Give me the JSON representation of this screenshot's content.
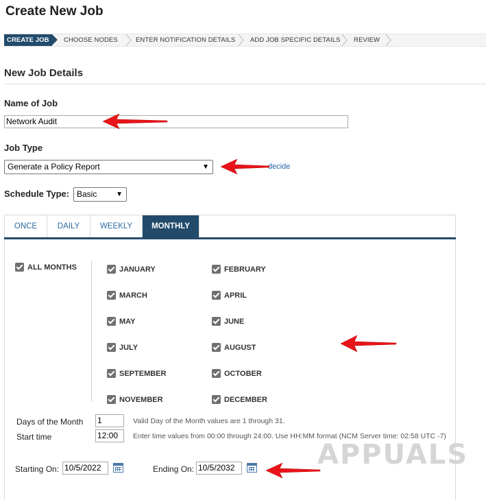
{
  "page": {
    "title": "Create New Job"
  },
  "wizard": {
    "steps": [
      {
        "label": "CREATE JOB"
      },
      {
        "label": "CHOOSE NODES"
      },
      {
        "label": "ENTER NOTIFICATION DETAILS"
      },
      {
        "label": "ADD JOB SPECIFIC DETAILS"
      },
      {
        "label": "REVIEW"
      }
    ]
  },
  "section": {
    "title": "New Job Details"
  },
  "name_of_job": {
    "label": "Name of Job",
    "value": "Network Audit"
  },
  "job_type": {
    "label": "Job Type",
    "selected": "Generate a Policy Report",
    "help_link": "decide"
  },
  "schedule_type": {
    "label": "Schedule Type:",
    "selected": "Basic"
  },
  "tabs": [
    {
      "label": "ONCE"
    },
    {
      "label": "DAILY"
    },
    {
      "label": "WEEKLY"
    },
    {
      "label": "MONTHLY"
    }
  ],
  "months": {
    "all_label": "ALL MONTHS",
    "items": [
      {
        "label": "JANUARY",
        "checked": true
      },
      {
        "label": "FEBRUARY",
        "checked": true
      },
      {
        "label": "MARCH",
        "checked": true
      },
      {
        "label": "APRIL",
        "checked": true
      },
      {
        "label": "MAY",
        "checked": true
      },
      {
        "label": "JUNE",
        "checked": true
      },
      {
        "label": "JULY",
        "checked": true
      },
      {
        "label": "AUGUST",
        "checked": true
      },
      {
        "label": "SEPTEMBER",
        "checked": true
      },
      {
        "label": "OCTOBER",
        "checked": true
      },
      {
        "label": "NOVEMBER",
        "checked": true
      },
      {
        "label": "DECEMBER",
        "checked": true
      }
    ]
  },
  "days_of_month": {
    "label": "Days of the Month",
    "value": "1",
    "hint": "Valid Day of the Month values are 1 through 31."
  },
  "start_time": {
    "label": "Start time",
    "value": "12:00",
    "hint": "Enter time values from 00:00 through 24:00. Use HH:MM format (NCM Server time: 02:58 UTC -7)"
  },
  "starting_on": {
    "label": "Starting On:",
    "value": "10/5/2022"
  },
  "ending_on": {
    "label": "Ending On:",
    "value": "10/5/2032"
  },
  "watermark": "APPUALS",
  "colors": {
    "accent": "#224b6b",
    "link": "#2d6a9f",
    "annotation_arrow": "#e8141a"
  }
}
